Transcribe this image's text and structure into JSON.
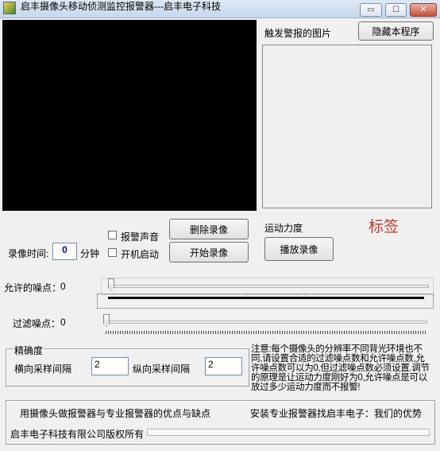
{
  "window": {
    "title": "启丰摄像头移动侦测监控报警器---启丰电子科技",
    "minimize_glyph": "▭",
    "maximize_glyph": "☐",
    "close_glyph": "✕"
  },
  "alarm_panel": {
    "label": "触发警报的图片",
    "hide_button": "隐藏本程序"
  },
  "controls": {
    "alarm_sound_label": "报警声音",
    "autostart_label": "开机启动",
    "delete_recording_button": "删除录像",
    "start_recording_button": "开始录像",
    "motion_strength_label": "运动力度",
    "play_recording_button": "播放录像",
    "tag_label": "标签",
    "record_time_label": "录像时间:",
    "record_time_value": "0",
    "record_time_unit": "分钟"
  },
  "sliders": {
    "allowed_noise_label": "允许的噪点：",
    "allowed_noise_value": "0",
    "filter_noise_label": "过滤噪点：",
    "filter_noise_value": "0"
  },
  "precision": {
    "group_label": "精确度",
    "horizontal_label": "横向采样间隔",
    "horizontal_value": "2",
    "vertical_label": "纵向采样间隔",
    "vertical_value": "2"
  },
  "note": "注意:每个摄像头的分辨率不同背光环境也不同,请设置合适的过滤噪点数和允许噪点数,允许噪点数可以为0,但过滤噪点数必须设置.调节的原理是让运动力度刚好为0,允许噪点是可以放过多少运动力度而不报警!",
  "footer": {
    "link_left": "用摄像头做报警器与专业报警器的优点与缺点",
    "link_right": "安装专业报警器找启丰电子：我们的优势",
    "copyright": "启丰电子科技有限公司版权所有"
  },
  "colors": {
    "tag_text": "#c0392b",
    "record_value_text": "#0000cc"
  }
}
